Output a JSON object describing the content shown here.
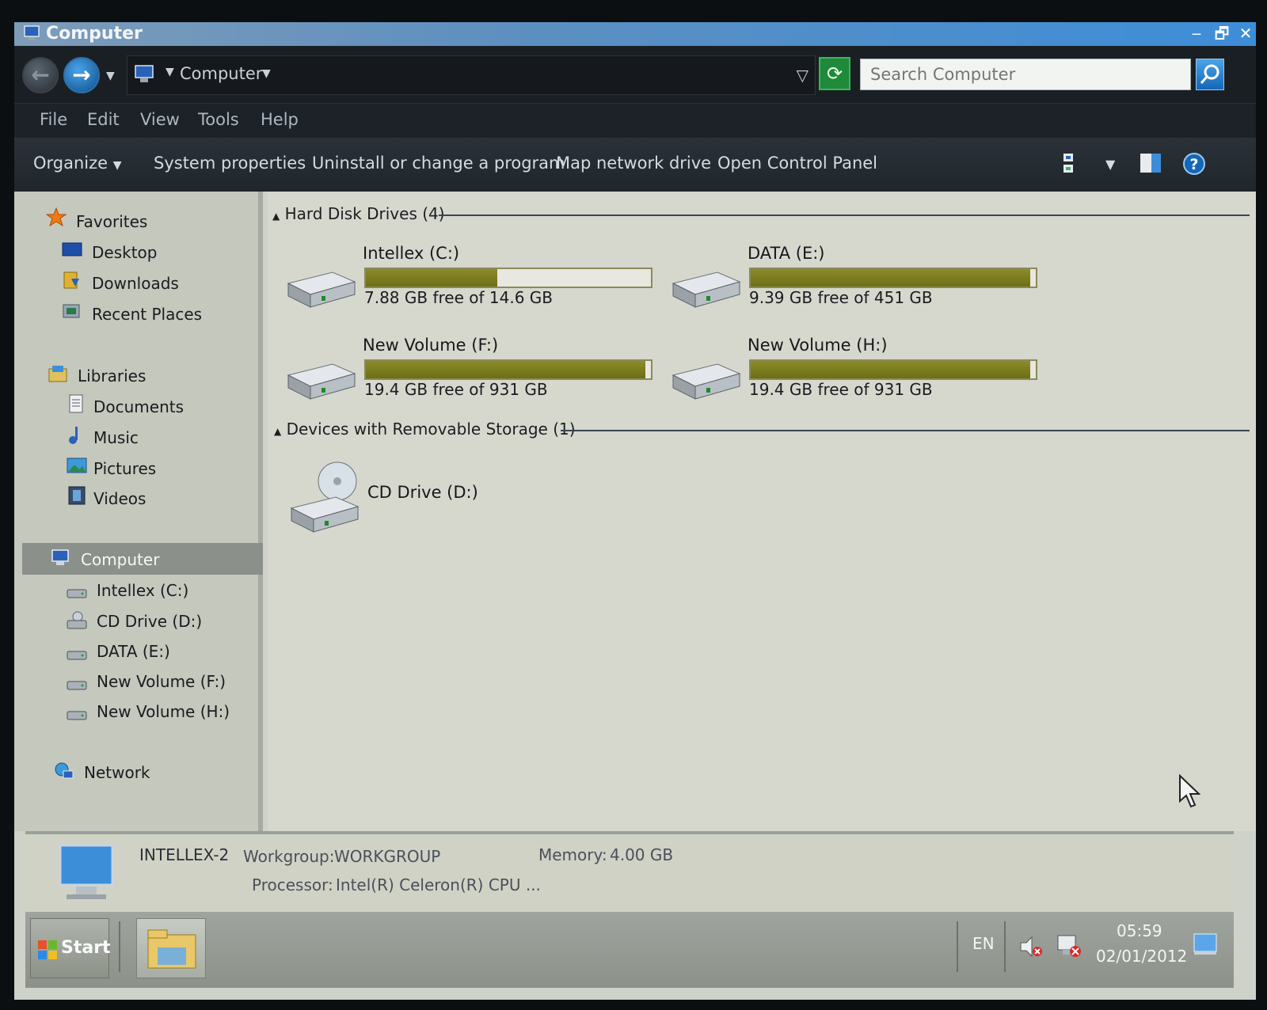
{
  "window": {
    "title": "Computer",
    "minimize": "‒",
    "restore": "🗗",
    "close": "✕"
  },
  "address": {
    "location": "Computer",
    "search_placeholder": "Search Computer"
  },
  "menu": {
    "file": "File",
    "edit": "Edit",
    "view": "View",
    "tools": "Tools",
    "help": "Help"
  },
  "toolbar": {
    "organize": "Organize",
    "system_properties": "System properties",
    "uninstall": "Uninstall or change a program",
    "map_drive": "Map network drive",
    "control_panel": "Open Control Panel"
  },
  "nav": {
    "favorites": "Favorites",
    "desktop": "Desktop",
    "downloads": "Downloads",
    "recent_places": "Recent Places",
    "libraries": "Libraries",
    "documents": "Documents",
    "music": "Music",
    "pictures": "Pictures",
    "videos": "Videos",
    "computer": "Computer",
    "drive_c": "Intellex (C:)",
    "drive_d": "CD Drive (D:)",
    "drive_e": "DATA (E:)",
    "drive_f": "New Volume (F:)",
    "drive_h": "New Volume (H:)",
    "network": "Network"
  },
  "groups": {
    "hard_disks": "Hard Disk Drives (4)",
    "removable": "Devices with Removable Storage (1)"
  },
  "drives": [
    {
      "name": "Intellex (C:)",
      "free_text": "7.88 GB free of 14.6 GB",
      "used_fraction": 0.46
    },
    {
      "name": "DATA (E:)",
      "free_text": "9.39 GB free of 451 GB",
      "used_fraction": 0.98
    },
    {
      "name": "New Volume (F:)",
      "free_text": "19.4 GB free of 931 GB",
      "used_fraction": 0.98
    },
    {
      "name": "New Volume (H:)",
      "free_text": "19.4 GB free of 931 GB",
      "used_fraction": 0.98
    }
  ],
  "removable": [
    {
      "name": "CD Drive (D:)"
    }
  ],
  "details": {
    "computer_name": "INTELLEX-2",
    "workgroup_label": "Workgroup:",
    "workgroup": "WORKGROUP",
    "memory_label": "Memory:",
    "memory": "4.00 GB",
    "processor_label": "Processor:",
    "processor": "Intel(R) Celeron(R) CPU ..."
  },
  "taskbar": {
    "start": "Start",
    "language": "EN",
    "time": "05:59",
    "date": "02/01/2012"
  },
  "colors": {
    "bar_fill": "#7a7a1c",
    "title_bar": "#3d8ed8"
  }
}
